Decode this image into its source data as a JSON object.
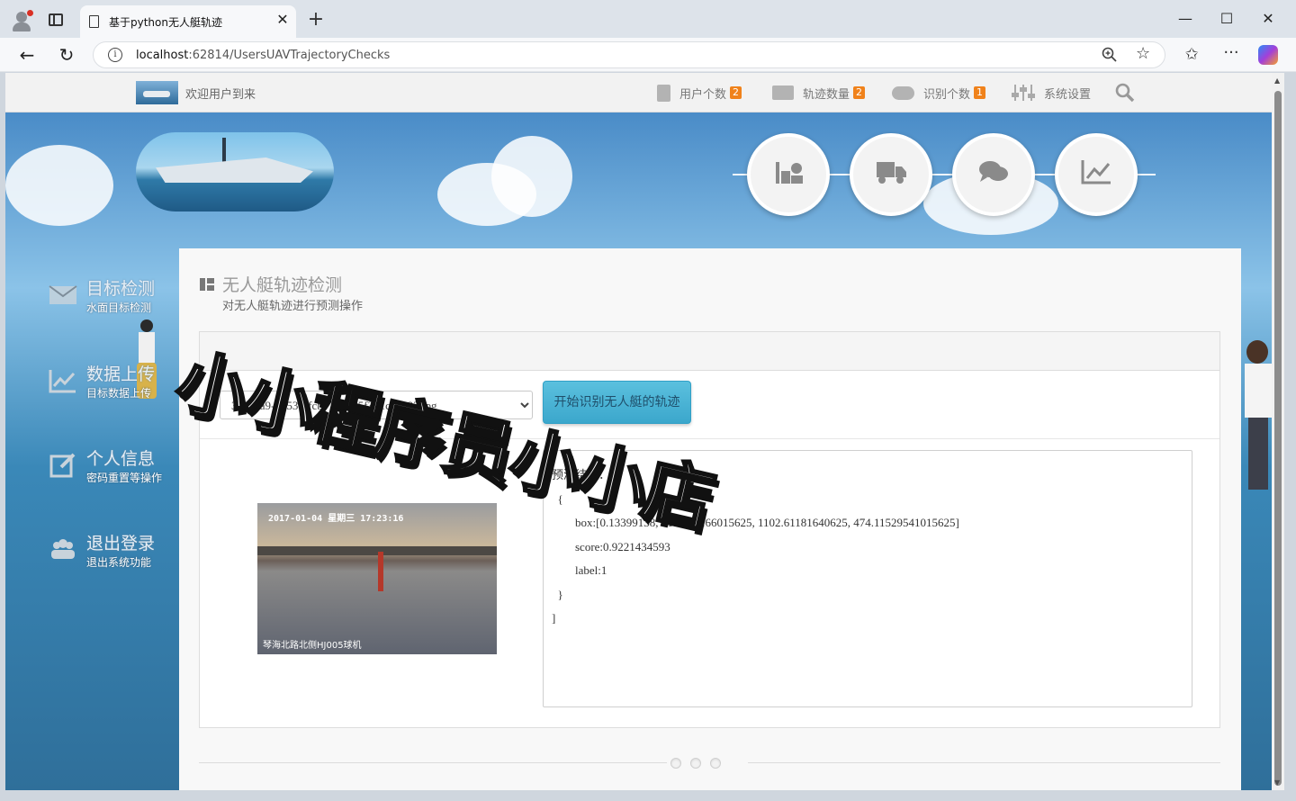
{
  "browser": {
    "tab_title": "基于python无人艇轨迹",
    "tab_close": "✕",
    "new_tab": "+",
    "url_host": "localhost",
    "url_rest": ":62814/UsersUAVTrajectoryChecks",
    "info_glyph": "i",
    "minimize": "—",
    "maximize": "☐",
    "close": "✕",
    "back": "←",
    "reload": "↻",
    "star": "☆",
    "favorites": "✩",
    "more": "···"
  },
  "topnav": {
    "welcome": "欢迎用户到来",
    "items": [
      {
        "label": "用户个数",
        "badge": "2",
        "icon": "document-icon"
      },
      {
        "label": "轨迹数量",
        "badge": "2",
        "icon": "envelope-icon"
      },
      {
        "label": "识别个数",
        "badge": "1",
        "icon": "cloud-icon"
      },
      {
        "label": "系统设置",
        "badge": "",
        "icon": "sliders-icon"
      }
    ]
  },
  "sidebar": {
    "items": [
      {
        "title": "目标检测",
        "sub": "水面目标检测",
        "icon": "envelope-icon"
      },
      {
        "title": "数据上传",
        "sub": "目标数据上传",
        "icon": "chart-icon"
      },
      {
        "title": "个人信息",
        "sub": "密码重置等操作",
        "icon": "edit-icon"
      },
      {
        "title": "退出登录",
        "sub": "退出系统功能",
        "icon": "users-icon"
      }
    ]
  },
  "page": {
    "title": "无人艇轨迹检测",
    "subtitle": "对无人艇轨迹进行预测操作",
    "select_value": "3916ca9-0353-4fcb-9f92-b5f3b1c9c393.jpg",
    "start_button": "开始识别无人艇的轨迹",
    "photo_stamp": "2017-01-04  星期三  17:23:16",
    "photo_caption": "琴海北路北侧HJ005球机",
    "result_text": "预测结果：[\n  {\n        box:[0.13399138, 41.7545166015625, 1102.61181640625, 474.11529541015625]\n        score:0.9221434593\n        label:1\n  }\n]"
  },
  "watermark": "小小程序员小小店",
  "colors": {
    "accent": "#5bc0de",
    "badge": "#f0821b"
  }
}
